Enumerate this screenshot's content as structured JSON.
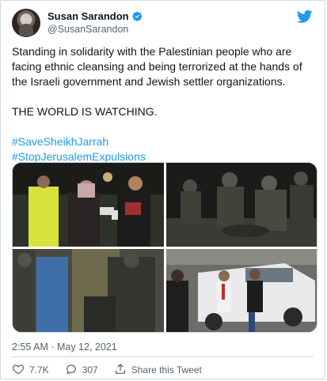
{
  "tweet": {
    "author_name": "Susan Sarandon",
    "author_handle": "@SusanSarandon",
    "paragraph1": "Standing in solidarity with the Palestinian people who are facing ethnic cleansing and being terrorized at the hands of the Israeli government and Jewish settler organizations.",
    "paragraph2": "THE WORLD IS WATCHING.",
    "hashtags": [
      "#SaveSheikhJarrah",
      "#StopJerusalemExpulsions"
    ],
    "timestamp": "2:55 AM · May 12, 2021",
    "likes": "7.7K",
    "replies": "307",
    "share_label": "Share this Tweet"
  },
  "icons": {
    "brand": "twitter-bird-icon",
    "verified": "verified-badge-icon",
    "like": "heart-icon",
    "reply": "reply-bubble-icon",
    "share": "share-icon"
  },
  "colors": {
    "accent": "#1d9bf0",
    "text": "#0f1419",
    "muted": "#536471",
    "border": "#cfd9de"
  }
}
